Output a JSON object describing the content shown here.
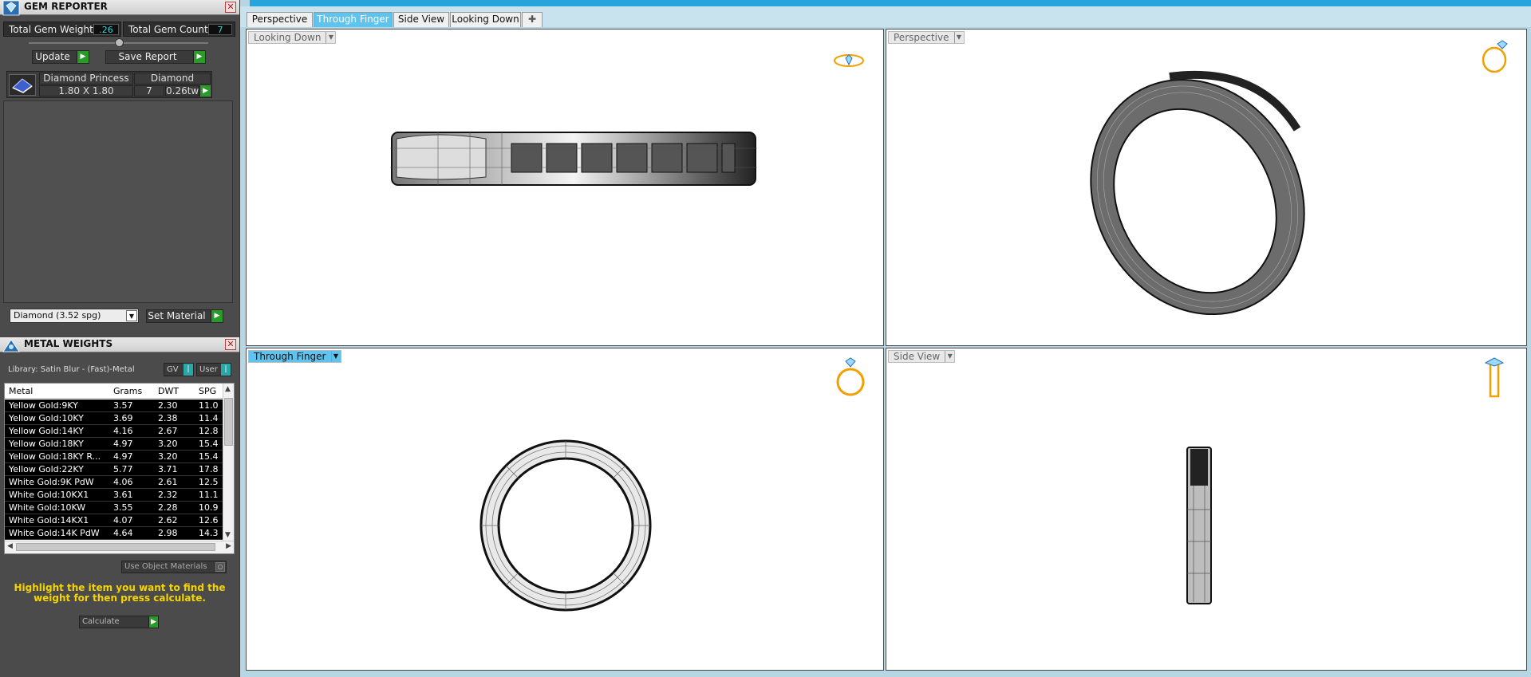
{
  "gem_reporter": {
    "title": "GEM REPORTER",
    "total_weight_label": "Total Gem Weight",
    "total_weight_value": ".26",
    "total_count_label": "Total Gem Count",
    "total_count_value": "7",
    "update_label": "Update",
    "save_report_label": "Save Report",
    "gem_headers": [
      "Diamond Princess",
      "Diamond"
    ],
    "gem_row": {
      "size": "1.80 X 1.80",
      "count": "7",
      "weight": "0.26tw"
    },
    "material_select": "Diamond    (3.52 spg)",
    "set_material_label": "Set Material"
  },
  "metal_weights": {
    "title": "METAL WEIGHTS",
    "library": "Library: Satin Blur - (Fast)-Metal",
    "gv_label": "GV",
    "user_label": "User",
    "columns": [
      "Metal",
      "Grams",
      "DWT",
      "SPG"
    ],
    "rows": [
      [
        "Yellow Gold:9KY",
        "3.57",
        "2.30",
        "11.0"
      ],
      [
        "Yellow Gold:10KY",
        "3.69",
        "2.38",
        "11.4"
      ],
      [
        "Yellow Gold:14KY",
        "4.16",
        "2.67",
        "12.8"
      ],
      [
        "Yellow Gold:18KY",
        "4.97",
        "3.20",
        "15.4"
      ],
      [
        "Yellow Gold:18KY R...",
        "4.97",
        "3.20",
        "15.4"
      ],
      [
        "Yellow Gold:22KY",
        "5.77",
        "3.71",
        "17.8"
      ],
      [
        "White Gold:9K PdW",
        "4.06",
        "2.61",
        "12.5"
      ],
      [
        "White Gold:10KX1",
        "3.61",
        "2.32",
        "11.1"
      ],
      [
        "White Gold:10KW",
        "3.55",
        "2.28",
        "10.9"
      ],
      [
        "White Gold:14KX1",
        "4.07",
        "2.62",
        "12.6"
      ],
      [
        "White Gold:14K PdW",
        "4.64",
        "2.98",
        "14.3"
      ]
    ],
    "use_object_materials": "Use Object Materials",
    "hint": "Highlight the item you want to find the weight for then press calculate.",
    "calculate_label": "Calculate"
  },
  "viewport_tabs": [
    "Perspective",
    "Through Finger",
    "Side View",
    "Looking Down"
  ],
  "active_tab": "Through Finger",
  "viewports": {
    "tl": "Looking Down",
    "tr": "Perspective",
    "bl": "Through Finger",
    "br": "Side View"
  },
  "colors": {
    "accent": "#5fc3ee",
    "highlight_text": "#f5d400",
    "ok_green": "#2a9a2a"
  }
}
